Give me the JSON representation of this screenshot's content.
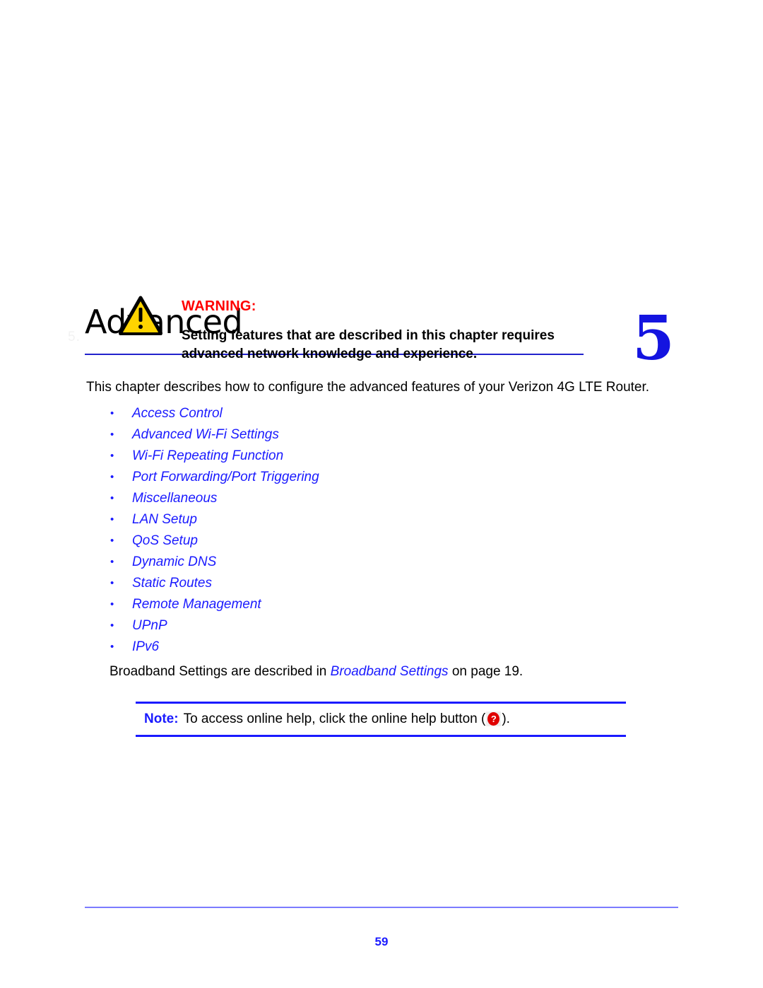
{
  "chapter": {
    "watermark": "5.",
    "title": "Advanced",
    "number": "5"
  },
  "warning": {
    "icon_name": "warning-triangle-icon",
    "label": "WARNING:",
    "line1": "Setting features that are described in this chapter requires",
    "line2": "advanced network knowledge and experience."
  },
  "intro": {
    "paragraph": "This chapter describes how to configure the advanced features of your Verizon 4G LTE Router."
  },
  "links": [
    {
      "bullet": "•",
      "label": "Access Control"
    },
    {
      "bullet": "•",
      "label": "Advanced Wi-Fi Settings"
    },
    {
      "bullet": "•",
      "label": "Wi-Fi Repeating Function"
    },
    {
      "bullet": "•",
      "label": "Port Forwarding/Port Triggering"
    },
    {
      "bullet": "•",
      "label": "Miscellaneous"
    },
    {
      "bullet": "•",
      "label": "LAN Setup"
    },
    {
      "bullet": "•",
      "label": "QoS Setup"
    },
    {
      "bullet": "•",
      "label": "Dynamic DNS"
    },
    {
      "bullet": "•",
      "label": "Static Routes"
    },
    {
      "bullet": "•",
      "label": "Remote Management"
    },
    {
      "bullet": "•",
      "label": "UPnP"
    },
    {
      "bullet": "•",
      "label": "IPv6"
    }
  ],
  "broadband": {
    "prefix": "Broadband Settings are described in ",
    "xref": "Broadband Settings",
    "suffix": " on page 19."
  },
  "note": {
    "label": "Note:",
    "text_before": "To access online help, click the online help button (",
    "help_icon_glyph": "?",
    "help_icon_name": "online-help-button-icon",
    "text_after": ")."
  },
  "footer": {
    "page_number": "59"
  },
  "colors": {
    "link_blue": "#1a1aff",
    "rule_blue": "#2222cc",
    "footer_rule": "#7b7bff",
    "warning_red": "#ff0000",
    "warning_yellow": "#ffd400",
    "help_red": "#e00000"
  }
}
